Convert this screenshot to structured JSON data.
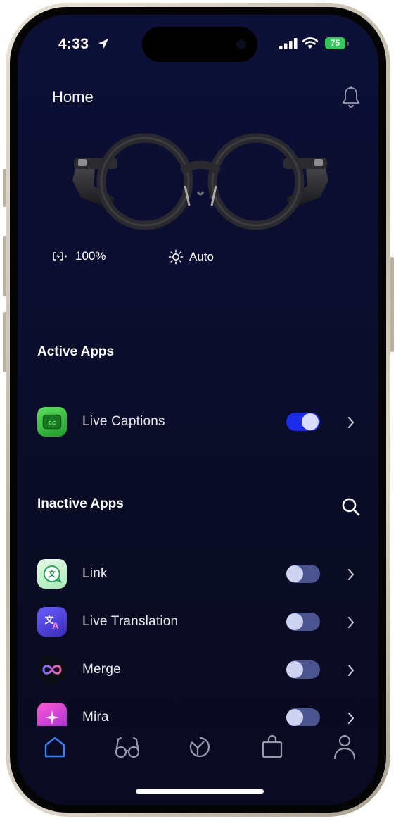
{
  "status_bar": {
    "time": "4:33",
    "battery_level": "75"
  },
  "header": {
    "title": "Home"
  },
  "device": {
    "battery": "100%",
    "brightness": "Auto"
  },
  "active_apps": {
    "title": "Active Apps",
    "items": [
      {
        "name": "Live Captions",
        "enabled": true
      }
    ]
  },
  "inactive_apps": {
    "title": "Inactive Apps",
    "items": [
      {
        "name": "Link",
        "enabled": false
      },
      {
        "name": "Live Translation",
        "enabled": false
      },
      {
        "name": "Merge",
        "enabled": false
      },
      {
        "name": "Mira",
        "enabled": false
      }
    ]
  },
  "tab_bar": {
    "items": [
      "home-icon",
      "glasses-icon",
      "store-icon",
      "bag-icon",
      "profile-icon"
    ],
    "active": "home-icon"
  },
  "colors": {
    "accent": "#1b2de8",
    "background": "#0b0e30",
    "active_tab": "#3b82f6"
  }
}
